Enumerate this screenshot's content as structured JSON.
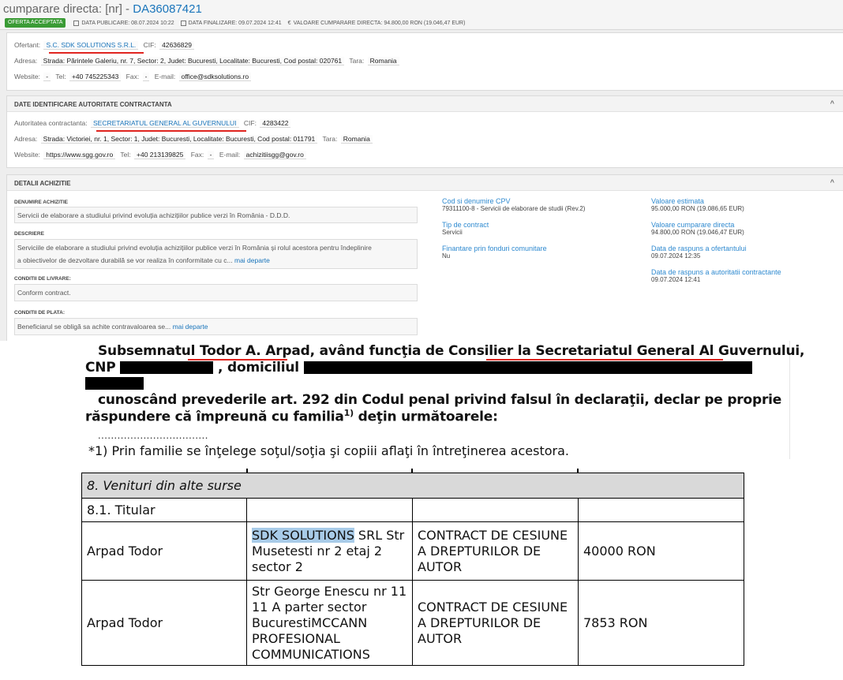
{
  "header": {
    "title_prefix": "cumparare directa: [nr] -",
    "title_number": "DA36087421",
    "status_badge": "OFERTA ACCEPTATA",
    "date_published": "DATA PUBLICARE: 08.07.2024 10:22",
    "date_finalized": "DATA FINALIZARE: 09.07.2024 12:41",
    "value": "VALOARE CUMPARARE DIRECTA: 94.800,00 RON (19.046,47 EUR)"
  },
  "bidder": {
    "name_label": "Ofertant:",
    "name": "S.C. SDK SOLUTIONS S.R.L.",
    "cif_label": "CIF:",
    "cif": "42636829",
    "address_label": "Adresa:",
    "address": "Strada: Părintele Galeriu, nr. 7, Sector: 2, Judet: Bucuresti, Localitate: Bucuresti, Cod postal: 020761",
    "country_label": "Tara:",
    "country": "Romania",
    "website_label": "Website:",
    "website": "-",
    "tel_label": "Tel:",
    "tel": "+40 745225343",
    "fax_label": "Fax:",
    "fax": "-",
    "email_label": "E-mail:",
    "email": "office@sdksolutions.ro"
  },
  "authority": {
    "section_title": "DATE IDENTIFICARE AUTORITATE CONTRACTANTA",
    "name_label": "Autoritatea contractanta:",
    "name": "SECRETARIATUL GENERAL AL GUVERNULUI",
    "cif_label": "CIF:",
    "cif": "4283422",
    "address_label": "Adresa:",
    "address": "Strada: Victoriei, nr. 1, Sector: 1, Judet: Bucuresti, Localitate: Bucuresti, Cod postal: 011791",
    "country_label": "Tara:",
    "country": "Romania",
    "website_label": "Website:",
    "website": "https://www.sgg.gov.ro",
    "tel_label": "Tel:",
    "tel": "+40 213139825",
    "fax_label": "Fax:",
    "fax": "-",
    "email_label": "E-mail:",
    "email": "achizitiisgg@gov.ro"
  },
  "acquisition": {
    "section_title": "DETALII ACHIZITIE",
    "name_label": "DENUMIRE ACHIZITIE",
    "name": "Servicii de elaborare a studiului privind evoluția achizițiilor publice verzi în România - D.D.D.",
    "desc_label": "DESCRIERE",
    "desc_line1": "Serviciile de elaborare a studiului privind evoluția achizițiilor publice verzi în România și rolul acestora pentru îndeplinire",
    "desc_line2": "a obiectivelor de dezvoltare durabilă se vor realiza în conformitate cu c...",
    "more": "mai departe",
    "delivery_label": "CONDITII DE LIVRARE:",
    "delivery": "Conform contract.",
    "payment_label": "CONDITII DE PLATA:",
    "payment": "Beneficiarul se obligă sa achite contravaloarea se...",
    "cpv_label": "Cod si denumire CPV",
    "cpv": "79311100-8 - Servicii de elaborare de studii (Rev.2)",
    "contract_type_label": "Tip de contract",
    "contract_type": "Servicii",
    "eu_funds_label": "Finantare prin fonduri comunitare",
    "eu_funds": "Nu",
    "est_value_label": "Valoare estimata",
    "est_value": "95.000,00 RON (19.086,65 EUR)",
    "direct_value_label": "Valoare cumparare directa",
    "direct_value": "94.800,00 RON (19.046,47 EUR)",
    "bid_date_label": "Data de raspuns a ofertantului",
    "bid_date": "09.07.2024 12:35",
    "auth_date_label": "Data de raspuns a autoritatii contractante",
    "auth_date": "09.07.2024 12:41"
  },
  "declaration": {
    "l1_a": "Subsemnatul ",
    "l1_name": "Todor A. Arpad",
    "l1_b": ", având funcţia de Consilier la ",
    "l1_inst": "Secretariatul General Al Guvernului",
    "l1_c": ",",
    "l2_a": "CNP ",
    "l2_b": " , domiciliul ",
    "l4": "cunoscând prevederile art. 292 din Codul penal privind falsul în declaraţii, declar pe proprie",
    "l5": "răspundere că împreună cu familia",
    "l5_sup": "1)",
    "l5_end": " deţin următoarele:",
    "dots": "..................................",
    "footnote": "*1) Prin familie se înţelege soţul/soţia şi copiii aflaţi în întreţinerea acestora."
  },
  "income_table": {
    "section": "8. Venituri din alte surse",
    "subsection": "8.1. Titular",
    "rows": [
      {
        "holder": "Arpad Todor",
        "source_hl": "SDK SOLUTIONS",
        "source_rest": " SRL Str Musetesti nr 2 etaj 2 sector 2",
        "service": "CONTRACT DE CESIUNE A DREPTURILOR DE AUTOR",
        "amount": "40000 RON"
      },
      {
        "holder": "Arpad Todor",
        "source_hl": "",
        "source_rest": "Str George Enescu nr 11 11 A parter sector BucurestiMCCANN PROFESIONAL COMMUNICATIONS",
        "service": "CONTRACT DE CESIUNE A DREPTURILOR DE AUTOR",
        "amount": "7853 RON"
      }
    ]
  },
  "icons": [
    "calendar-icon",
    "euro-icon",
    "chevron-up-icon"
  ]
}
